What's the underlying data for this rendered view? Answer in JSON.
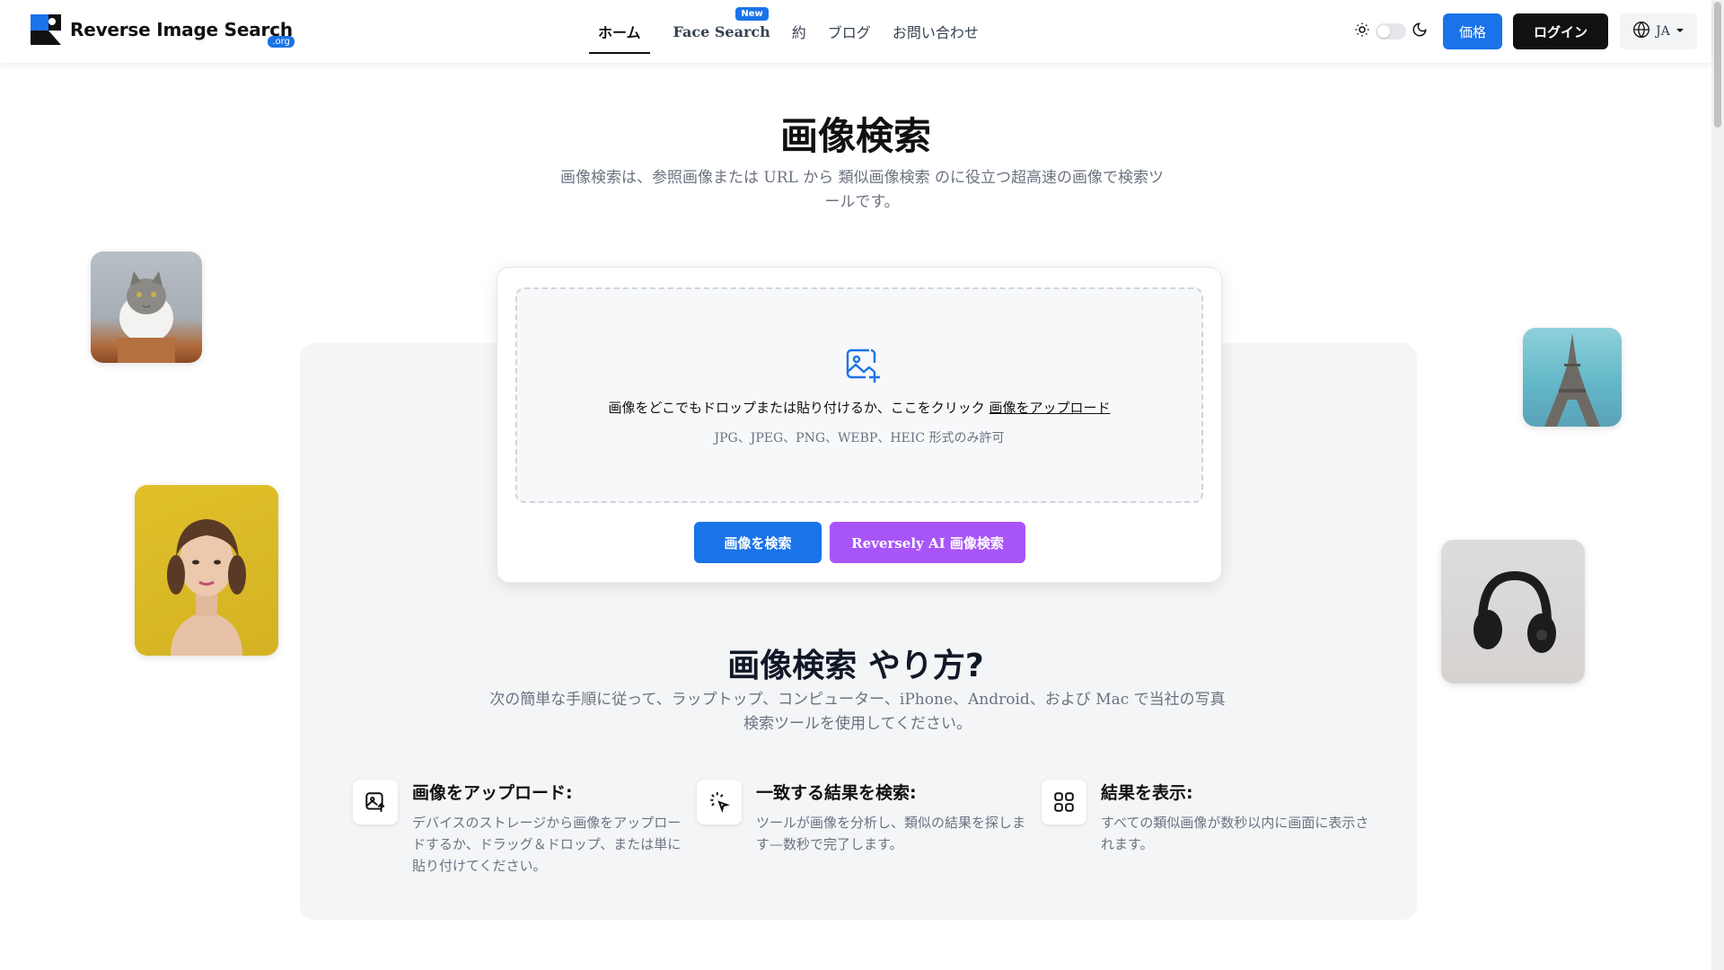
{
  "brand": {
    "name": "Reverse Image Search",
    "tld": ".org"
  },
  "nav": {
    "items": [
      {
        "label": "ホーム"
      },
      {
        "label": "Face Search",
        "badge": "New"
      },
      {
        "label": "約"
      },
      {
        "label": "ブログ"
      },
      {
        "label": "お問い合わせ"
      }
    ]
  },
  "header": {
    "pricing_label": "価格",
    "login_label": "ログイン",
    "language": "JA"
  },
  "hero": {
    "title": "画像検索",
    "subtitle": "画像検索は、参照画像または URL から 類似画像検索 のに役立つ超高速の画像で検索ツールです。"
  },
  "upload": {
    "prompt": "画像をどこでもドロップまたは貼り付けるか、ここをクリック",
    "link": "画像をアップロード",
    "formats": "JPG、JPEG、PNG、WEBP、HEIC 形式のみ許可",
    "search_button": "画像を検索",
    "ai_button": "Reversely AI 画像検索"
  },
  "how": {
    "title": "画像検索 やり方?",
    "subtitle": "次の簡単な手順に従って、ラップトップ、コンピューター、iPhone、Android、および Mac で当社の写真検索ツールを使用してください。",
    "steps": [
      {
        "icon": "image-upload-icon",
        "title": "画像をアップロード:",
        "text": "デバイスのストレージから画像をアップロードするか、ドラッグ＆ドロップ、または単に貼り付けてください。"
      },
      {
        "icon": "click-cursor-icon",
        "title": "一致する結果を検索:",
        "text": "ツールが画像を分析し、類似の結果を探します—数秒で完了します。"
      },
      {
        "icon": "grid-icon",
        "title": "結果を表示:",
        "text": "すべての類似画像が数秒以内に画面に表示されます。"
      }
    ]
  },
  "colors": {
    "primary": "#1a73e8",
    "ai_purple": "#a855f7",
    "dark": "#111111",
    "panel": "#f4f5f7"
  }
}
